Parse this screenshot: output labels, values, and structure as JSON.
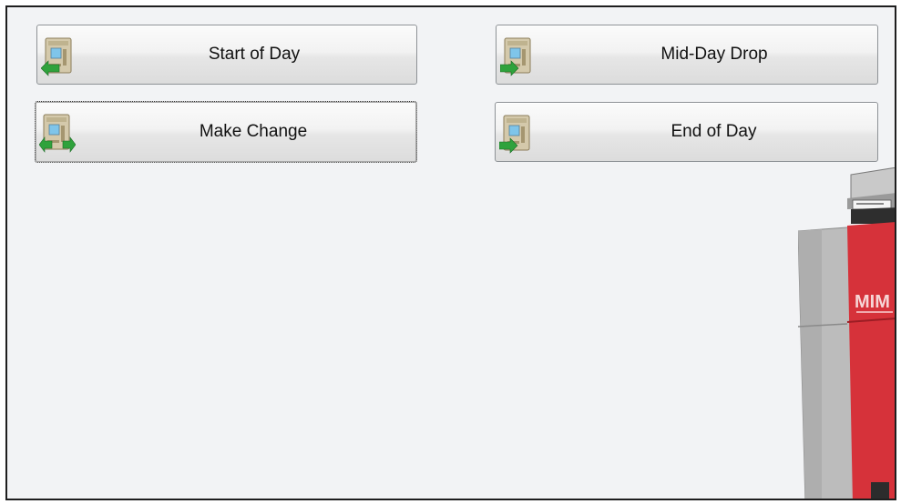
{
  "buttons": {
    "start_of_day": "Start of Day",
    "mid_day_drop": "Mid-Day Drop",
    "make_change": "Make Change",
    "end_of_day": "End of Day"
  },
  "machine": {
    "brand_text": "MIM"
  },
  "colors": {
    "brand_red": "#d6323a",
    "arrow_green": "#2fa23c",
    "panel_bg": "#f2f3f5"
  }
}
